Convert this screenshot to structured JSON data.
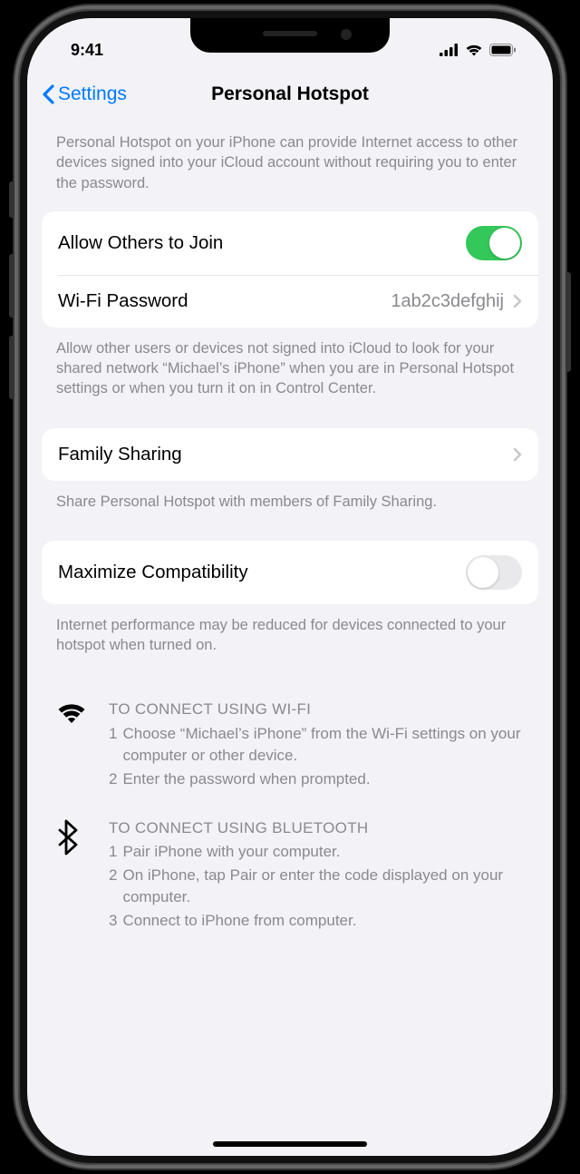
{
  "status": {
    "time": "9:41"
  },
  "nav": {
    "back": "Settings",
    "title": "Personal Hotspot"
  },
  "intro": "Personal Hotspot on your iPhone can provide Internet access to other devices signed into your iCloud account without requiring you to enter the password.",
  "group1": {
    "allow": {
      "label": "Allow Others to Join",
      "on": true
    },
    "wifi": {
      "label": "Wi-Fi Password",
      "value": "1ab2c3defghij"
    }
  },
  "footer1": "Allow other users or devices not signed into iCloud to look for your shared network “Michael’s iPhone” when you are in Personal Hotspot settings or when you turn it on in Control Center.",
  "group2": {
    "family": {
      "label": "Family Sharing"
    }
  },
  "footer2": "Share Personal Hotspot with members of Family Sharing.",
  "group3": {
    "max": {
      "label": "Maximize Compatibility",
      "on": false
    }
  },
  "footer3": "Internet performance may be reduced for devices connected to your hotspot when turned on.",
  "instructions": {
    "wifi": {
      "title": "TO CONNECT USING WI-FI",
      "steps": [
        "Choose “Michael’s iPhone” from the Wi-Fi settings on your computer or other device.",
        "Enter the password when prompted."
      ]
    },
    "bt": {
      "title": "TO CONNECT USING BLUETOOTH",
      "steps": [
        "Pair iPhone with your computer.",
        "On iPhone, tap Pair or enter the code displayed on your computer.",
        "Connect to iPhone from computer."
      ]
    }
  }
}
